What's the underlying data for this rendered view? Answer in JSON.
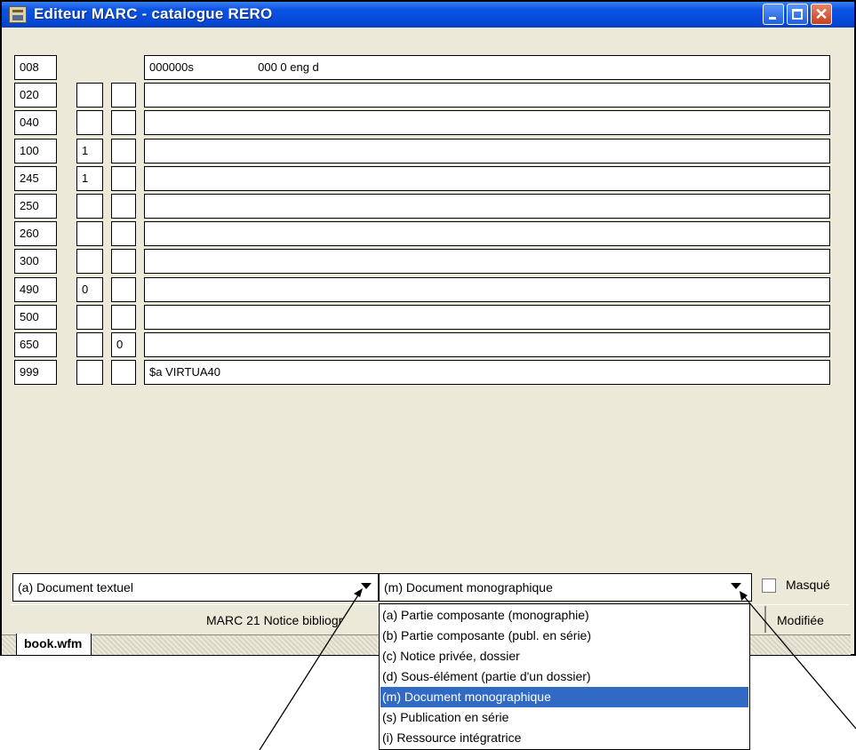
{
  "window": {
    "title": "Editeur MARC - catalogue RERO"
  },
  "fields": [
    {
      "tag": "008",
      "ind1": "",
      "ind2": "",
      "data": "000000s                    000 0 eng d",
      "has_indicators": false
    },
    {
      "tag": "020",
      "ind1": "",
      "ind2": "",
      "data": "",
      "has_indicators": true
    },
    {
      "tag": "040",
      "ind1": "",
      "ind2": "",
      "data": "",
      "has_indicators": true
    },
    {
      "tag": "100",
      "ind1": "1",
      "ind2": "",
      "data": "",
      "has_indicators": true
    },
    {
      "tag": "245",
      "ind1": "1",
      "ind2": "",
      "data": "",
      "has_indicators": true
    },
    {
      "tag": "250",
      "ind1": "",
      "ind2": "",
      "data": "",
      "has_indicators": true
    },
    {
      "tag": "260",
      "ind1": "",
      "ind2": "",
      "data": "",
      "has_indicators": true
    },
    {
      "tag": "300",
      "ind1": "",
      "ind2": "",
      "data": "",
      "has_indicators": true
    },
    {
      "tag": "490",
      "ind1": "0",
      "ind2": "",
      "data": "",
      "has_indicators": true
    },
    {
      "tag": "500",
      "ind1": "",
      "ind2": "",
      "data": "",
      "has_indicators": true
    },
    {
      "tag": "650",
      "ind1": "",
      "ind2": "0",
      "data": "",
      "has_indicators": true
    },
    {
      "tag": "999",
      "ind1": "",
      "ind2": "",
      "data": "$a VIRTUA40",
      "has_indicators": true
    }
  ],
  "type_select": {
    "value": "(a) Document textuel"
  },
  "level_select": {
    "value": "(m) Document monographique",
    "options": [
      "(a) Partie composante (monographie)",
      "(b) Partie composante (publ. en série)",
      "(c) Notice privée, dossier",
      "(d) Sous-élément (partie d'un dossier)",
      "(m) Document monographique",
      "(s) Publication en série",
      "(i) Ressource intégratrice"
    ],
    "selected_index": 4
  },
  "masked_checkbox": {
    "label": "Masqué",
    "checked": false
  },
  "status_bar": {
    "format": "MARC 21 Notice bibliogr",
    "state": "Modifiée"
  },
  "tabs": [
    {
      "label": "book.wfm"
    }
  ],
  "colors": {
    "titlebar": "#0a54e3",
    "window_bg": "#ece9d8",
    "selection": "#316ac5"
  }
}
